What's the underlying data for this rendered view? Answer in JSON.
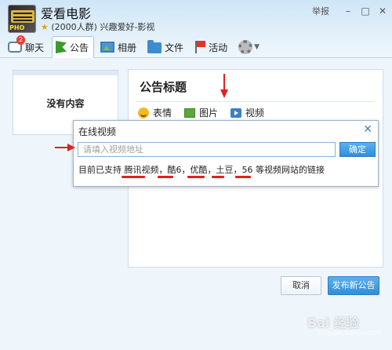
{
  "window": {
    "title": "爱看电影",
    "avatar_tag": "PHO",
    "subtitle_members": "(2000人群)",
    "subtitle_category": "兴趣爱好-影视",
    "report_label": "举报",
    "minimize": "–",
    "maximize": "□",
    "close": "✕"
  },
  "tabs": [
    {
      "label": "聊天",
      "icon": "chat-icon",
      "badge": "2"
    },
    {
      "label": "公告",
      "icon": "announcement-flag-icon"
    },
    {
      "label": "相册",
      "icon": "album-icon"
    },
    {
      "label": "文件",
      "icon": "folder-icon"
    },
    {
      "label": "活动",
      "icon": "activity-flag-icon"
    }
  ],
  "settings_icon": "gear-icon",
  "sidebar": {
    "empty_text": "没有内容"
  },
  "editor": {
    "title": "公告标题",
    "tools": [
      {
        "label": "表情",
        "icon": "emoji-icon"
      },
      {
        "label": "图片",
        "icon": "picture-icon"
      },
      {
        "label": "视频",
        "icon": "video-icon"
      }
    ]
  },
  "dialog": {
    "title": "在线视频",
    "close": "✕",
    "placeholder": "请填入视频地址",
    "ok_label": "确定",
    "note": "目前已支持 腾讯视频，酷6，优酷，土豆，56 等视频网站的链接"
  },
  "footer": {
    "cancel_label": "取消",
    "publish_label": "发布新公告"
  },
  "watermark": {
    "text": "Bai 经验",
    "sub": "jingyan.baidu.com"
  },
  "colors": {
    "accent": "#2f8fdc",
    "annotation": "#e02020"
  }
}
